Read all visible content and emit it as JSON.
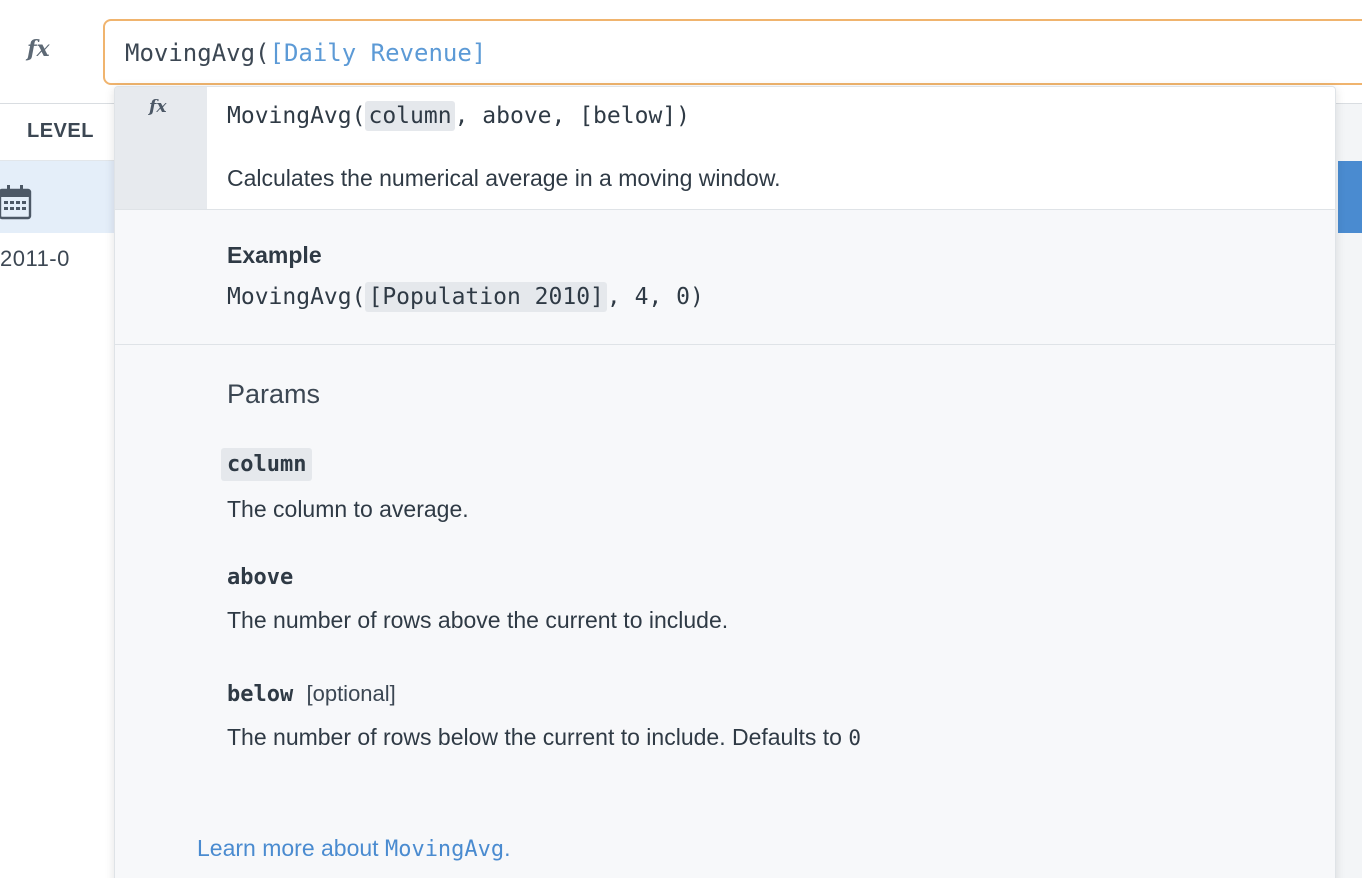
{
  "formula_bar": {
    "fx_label": "fx",
    "formula_prefix": "MovingAvg(",
    "formula_column_ref": "[Daily Revenue]"
  },
  "grid": {
    "header_label": "LEVEL",
    "date_value": "2011-0",
    "row_icon": "calendar-icon"
  },
  "popup": {
    "signature_icon_label": "fx",
    "signature": {
      "name": "MovingAvg(",
      "param_highlighted": "column",
      "rest": ", above, [below])"
    },
    "description": "Calculates the numerical average in a moving window.",
    "example": {
      "title": "Example",
      "code_prefix": "MovingAvg(",
      "code_highlighted": "[Population 2010]",
      "code_suffix": ", 4, 0)"
    },
    "params_title": "Params",
    "params": [
      {
        "name": "column",
        "optional_label": "",
        "description": "The column to average.",
        "description_code": ""
      },
      {
        "name": "above",
        "optional_label": "",
        "description": "The number of rows above the current to include.",
        "description_code": ""
      },
      {
        "name": "below",
        "optional_label": "[optional]",
        "description": "The number of rows below the current to include. Defaults to ",
        "description_code": "0"
      }
    ],
    "learn_more": {
      "prefix": "Learn more about ",
      "function_name": "MovingAvg",
      "suffix": "."
    }
  },
  "colors": {
    "input_focus_border": "#f0b46e",
    "column_ref": "#5c9ad6",
    "link": "#4a8bd0",
    "selected_row": "#e4eef9"
  }
}
